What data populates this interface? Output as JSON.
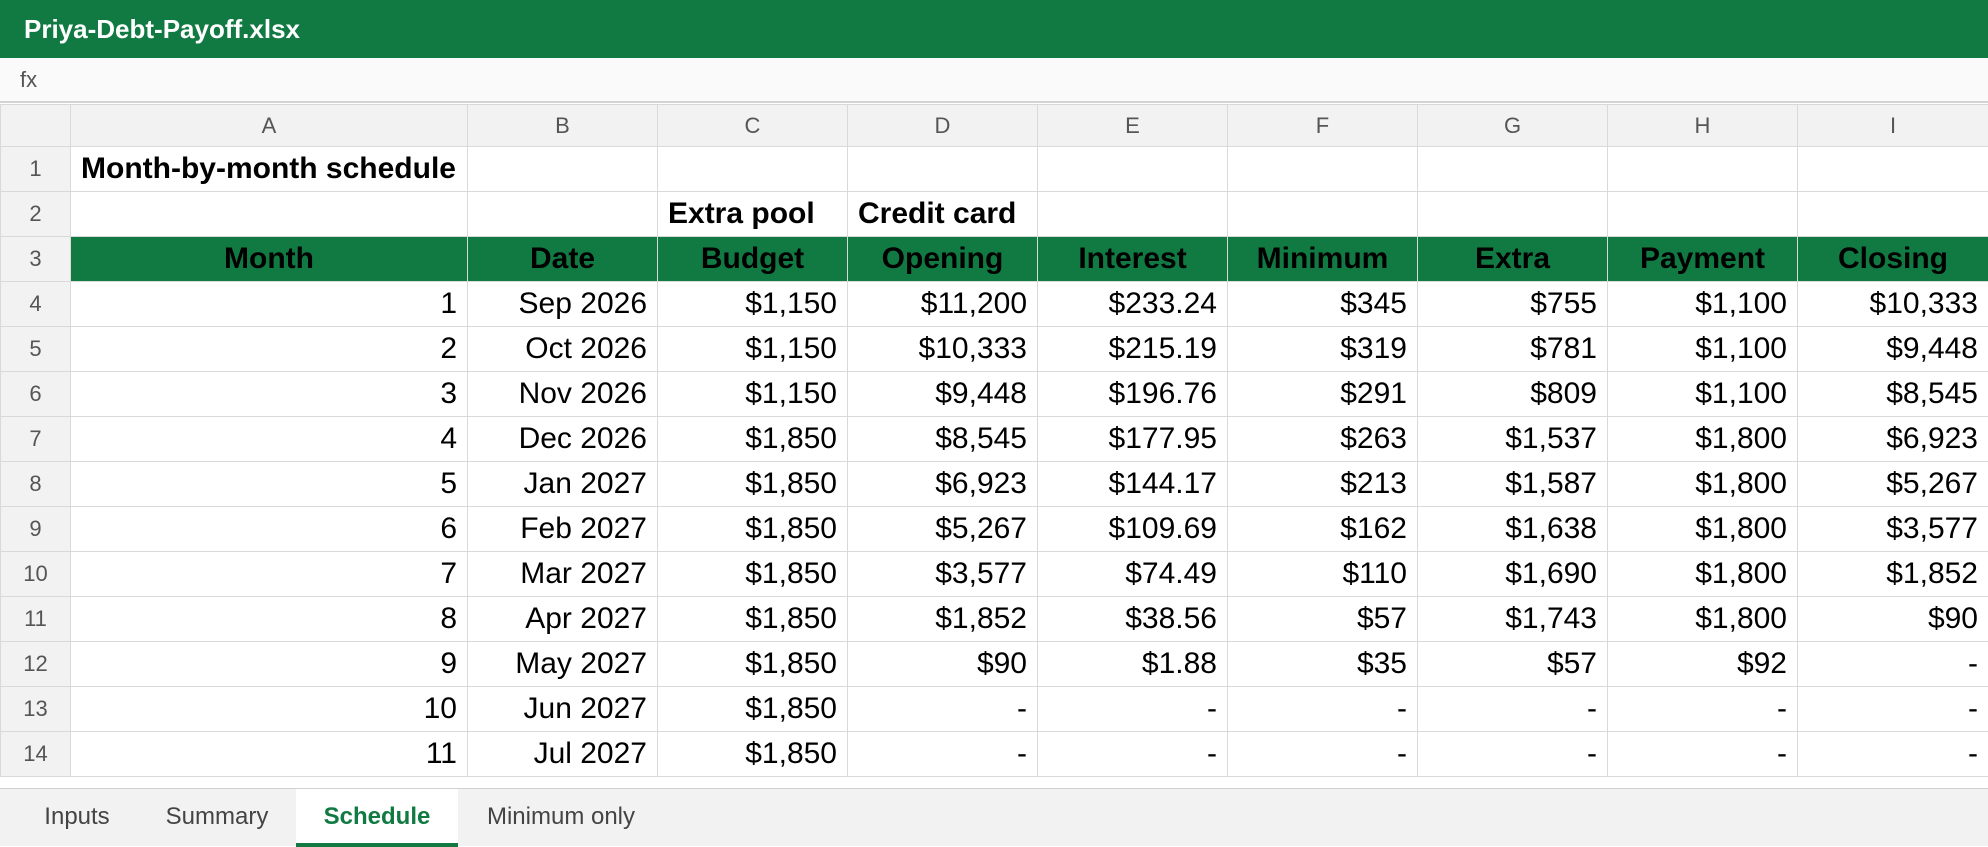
{
  "window": {
    "title": "Priya-Debt-Payoff.xlsx"
  },
  "formula_bar": {
    "fx_label": "fx",
    "content": ""
  },
  "columns": [
    "A",
    "B",
    "C",
    "D",
    "E",
    "F",
    "G",
    "H",
    "I"
  ],
  "sheet": {
    "title": "Month-by-month schedule",
    "group_headers": {
      "budget_group": "Extra pool",
      "card_group": "Credit card"
    },
    "headers": [
      "Month",
      "Date",
      "Budget",
      "Opening",
      "Interest",
      "Minimum",
      "Extra",
      "Payment",
      "Closing"
    ],
    "rows": [
      [
        "1",
        "Sep 2026",
        "$1,150",
        "$11,200",
        "$233.24",
        "$345",
        "$755",
        "$1,100",
        "$10,333"
      ],
      [
        "2",
        "Oct 2026",
        "$1,150",
        "$10,333",
        "$215.19",
        "$319",
        "$781",
        "$1,100",
        "$9,448"
      ],
      [
        "3",
        "Nov 2026",
        "$1,150",
        "$9,448",
        "$196.76",
        "$291",
        "$809",
        "$1,100",
        "$8,545"
      ],
      [
        "4",
        "Dec 2026",
        "$1,850",
        "$8,545",
        "$177.95",
        "$263",
        "$1,537",
        "$1,800",
        "$6,923"
      ],
      [
        "5",
        "Jan 2027",
        "$1,850",
        "$6,923",
        "$144.17",
        "$213",
        "$1,587",
        "$1,800",
        "$5,267"
      ],
      [
        "6",
        "Feb 2027",
        "$1,850",
        "$5,267",
        "$109.69",
        "$162",
        "$1,638",
        "$1,800",
        "$3,577"
      ],
      [
        "7",
        "Mar 2027",
        "$1,850",
        "$3,577",
        "$74.49",
        "$110",
        "$1,690",
        "$1,800",
        "$1,852"
      ],
      [
        "8",
        "Apr 2027",
        "$1,850",
        "$1,852",
        "$38.56",
        "$57",
        "$1,743",
        "$1,800",
        "$90"
      ],
      [
        "9",
        "May 2027",
        "$1,850",
        "$90",
        "$1.88",
        "$35",
        "$57",
        "$92",
        "-"
      ],
      [
        "10",
        "Jun 2027",
        "$1,850",
        "-",
        "-",
        "-",
        "-",
        "-",
        "-"
      ],
      [
        "11",
        "Jul 2027",
        "$1,850",
        "-",
        "-",
        "-",
        "-",
        "-",
        "-"
      ]
    ]
  },
  "row_numbers": [
    "1",
    "2",
    "3",
    "4",
    "5",
    "6",
    "7",
    "8",
    "9",
    "10",
    "11",
    "12",
    "13",
    "14"
  ],
  "tabs": [
    {
      "label": "Inputs",
      "active": false
    },
    {
      "label": "Summary",
      "active": false
    },
    {
      "label": "Schedule",
      "active": true
    },
    {
      "label": "Minimum only",
      "active": false
    }
  ],
  "colors": {
    "brand": "#117a43",
    "title_text": "#1a6b47"
  }
}
